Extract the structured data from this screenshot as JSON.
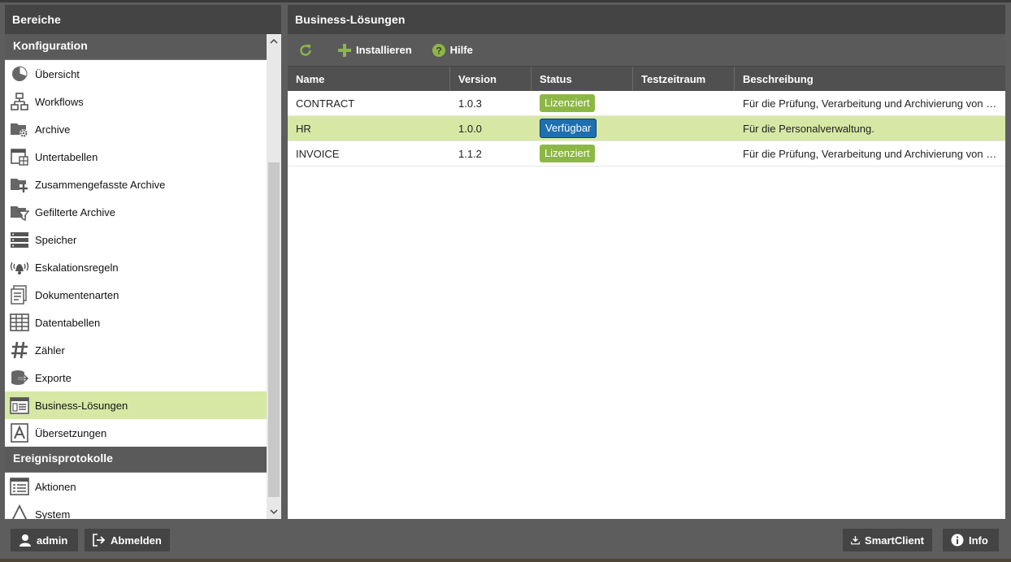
{
  "left": {
    "header": "Bereiche",
    "groups": [
      {
        "title": "Konfiguration",
        "items": [
          {
            "label": "Übersicht",
            "icon": "pie-chart-icon"
          },
          {
            "label": "Workflows",
            "icon": "workflow-icon"
          },
          {
            "label": "Archive",
            "icon": "archive-folder-gear-icon"
          },
          {
            "label": "Untertabellen",
            "icon": "subtable-icon"
          },
          {
            "label": "Zusammengefasste Archive",
            "icon": "archive-folder-plus-icon"
          },
          {
            "label": "Gefilterte Archive",
            "icon": "archive-folder-filter-icon"
          },
          {
            "label": "Speicher",
            "icon": "storage-icon"
          },
          {
            "label": "Eskalationsregeln",
            "icon": "alarm-bell-icon"
          },
          {
            "label": "Dokumentenarten",
            "icon": "document-types-icon"
          },
          {
            "label": "Datentabellen",
            "icon": "data-table-icon"
          },
          {
            "label": "Zähler",
            "icon": "hash-icon"
          },
          {
            "label": "Exporte",
            "icon": "export-icon"
          },
          {
            "label": "Business-Lösungen",
            "icon": "business-solutions-icon",
            "active": true
          },
          {
            "label": "Übersetzungen",
            "icon": "translation-icon"
          }
        ]
      },
      {
        "title": "Ereignisprotokolle",
        "items": [
          {
            "label": "Aktionen",
            "icon": "list-icon"
          },
          {
            "label": "System",
            "icon": "system-icon"
          }
        ]
      }
    ]
  },
  "main": {
    "header": "Business-Lösungen",
    "toolbar": {
      "refresh_icon": "refresh-icon",
      "install_label": "Installieren",
      "help_label": "Hilfe"
    },
    "columns": [
      "Name",
      "Version",
      "Status",
      "Testzeitraum",
      "Beschreibung"
    ],
    "rows": [
      {
        "name": "CONTRACT",
        "version": "1.0.3",
        "status": "Lizenziert",
        "status_type": "green",
        "trial": "",
        "description": "Für die Prüfung, Verarbeitung und Archivierung von Verträgen"
      },
      {
        "name": "HR",
        "version": "1.0.0",
        "status": "Verfügbar",
        "status_type": "blue",
        "trial": "",
        "description": "Für die Personalverwaltung.",
        "selected": true
      },
      {
        "name": "INVOICE",
        "version": "1.1.2",
        "status": "Lizenziert",
        "status_type": "green",
        "trial": "",
        "description": "Für die Prüfung, Verarbeitung und Archivierung von Rechnungen"
      }
    ]
  },
  "footer": {
    "user_label": "admin",
    "logout_label": "Abmelden",
    "smartclient_label": "SmartClient",
    "info_label": "Info"
  },
  "colors": {
    "accent_green": "#8db744",
    "selection": "#d6e8a4",
    "status_blue": "#1e6fb0",
    "header_dark": "#444444"
  }
}
